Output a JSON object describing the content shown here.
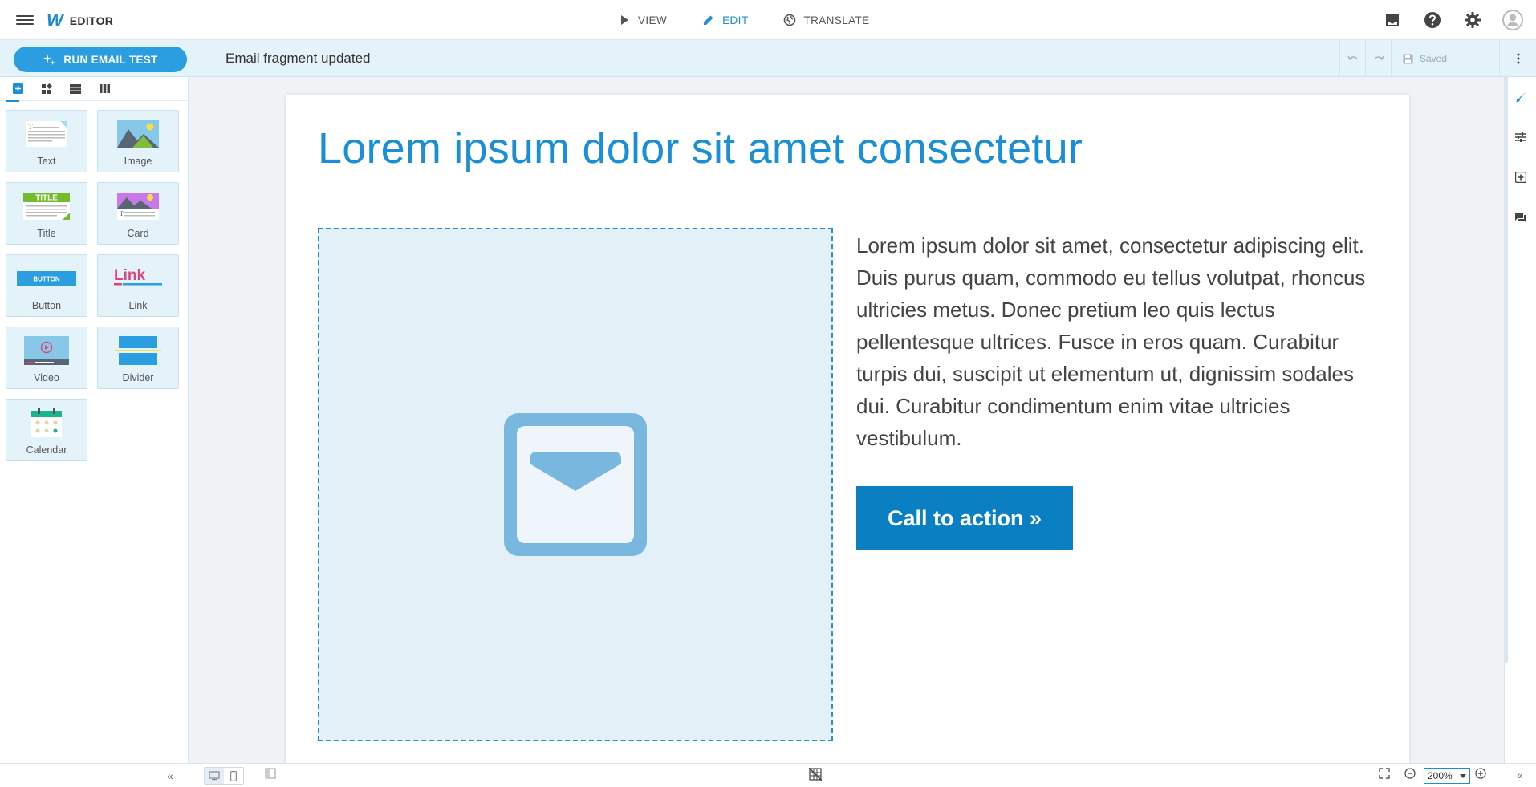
{
  "app": {
    "brand_logo": "W",
    "brand_name": "EDITOR"
  },
  "modes": [
    {
      "label": "VIEW",
      "icon": "play-icon"
    },
    {
      "label": "EDIT",
      "icon": "pencil-icon",
      "active": true
    },
    {
      "label": "TRANSLATE",
      "icon": "globe-icon"
    }
  ],
  "toolbar": {
    "run_label": "RUN EMAIL TEST",
    "status_message": "Email fragment updated",
    "saved_label": "Saved"
  },
  "blocks": [
    {
      "label": "Text"
    },
    {
      "label": "Image"
    },
    {
      "label": "Title",
      "thumb_text": "TITLE"
    },
    {
      "label": "Card"
    },
    {
      "label": "Button",
      "thumb_text": "BUTTON"
    },
    {
      "label": "Link",
      "thumb_text": "Link"
    },
    {
      "label": "Video"
    },
    {
      "label": "Divider"
    },
    {
      "label": "Calendar"
    }
  ],
  "email": {
    "title": "Lorem ipsum dolor sit amet consectetur",
    "body": "Lorem ipsum dolor sit amet, consectetur adipiscing elit. Duis purus quam, commodo eu tellus volutpat, rhoncus ultricies metus. Donec pretium leo quis lectus pellentesque ultrices. Fusce in eros quam. Curabitur turpis dui, suscipit ut elementum ut, dignissim sodales dui. Curabitur condimentum enim vitae ultricies vestibulum.",
    "cta_label": "Call to action »"
  },
  "bottom": {
    "zoom": "200%"
  },
  "colors": {
    "accent": "#1a8fd6",
    "cta": "#0a7fc2",
    "toolbar_bg": "#e4f2fa"
  }
}
